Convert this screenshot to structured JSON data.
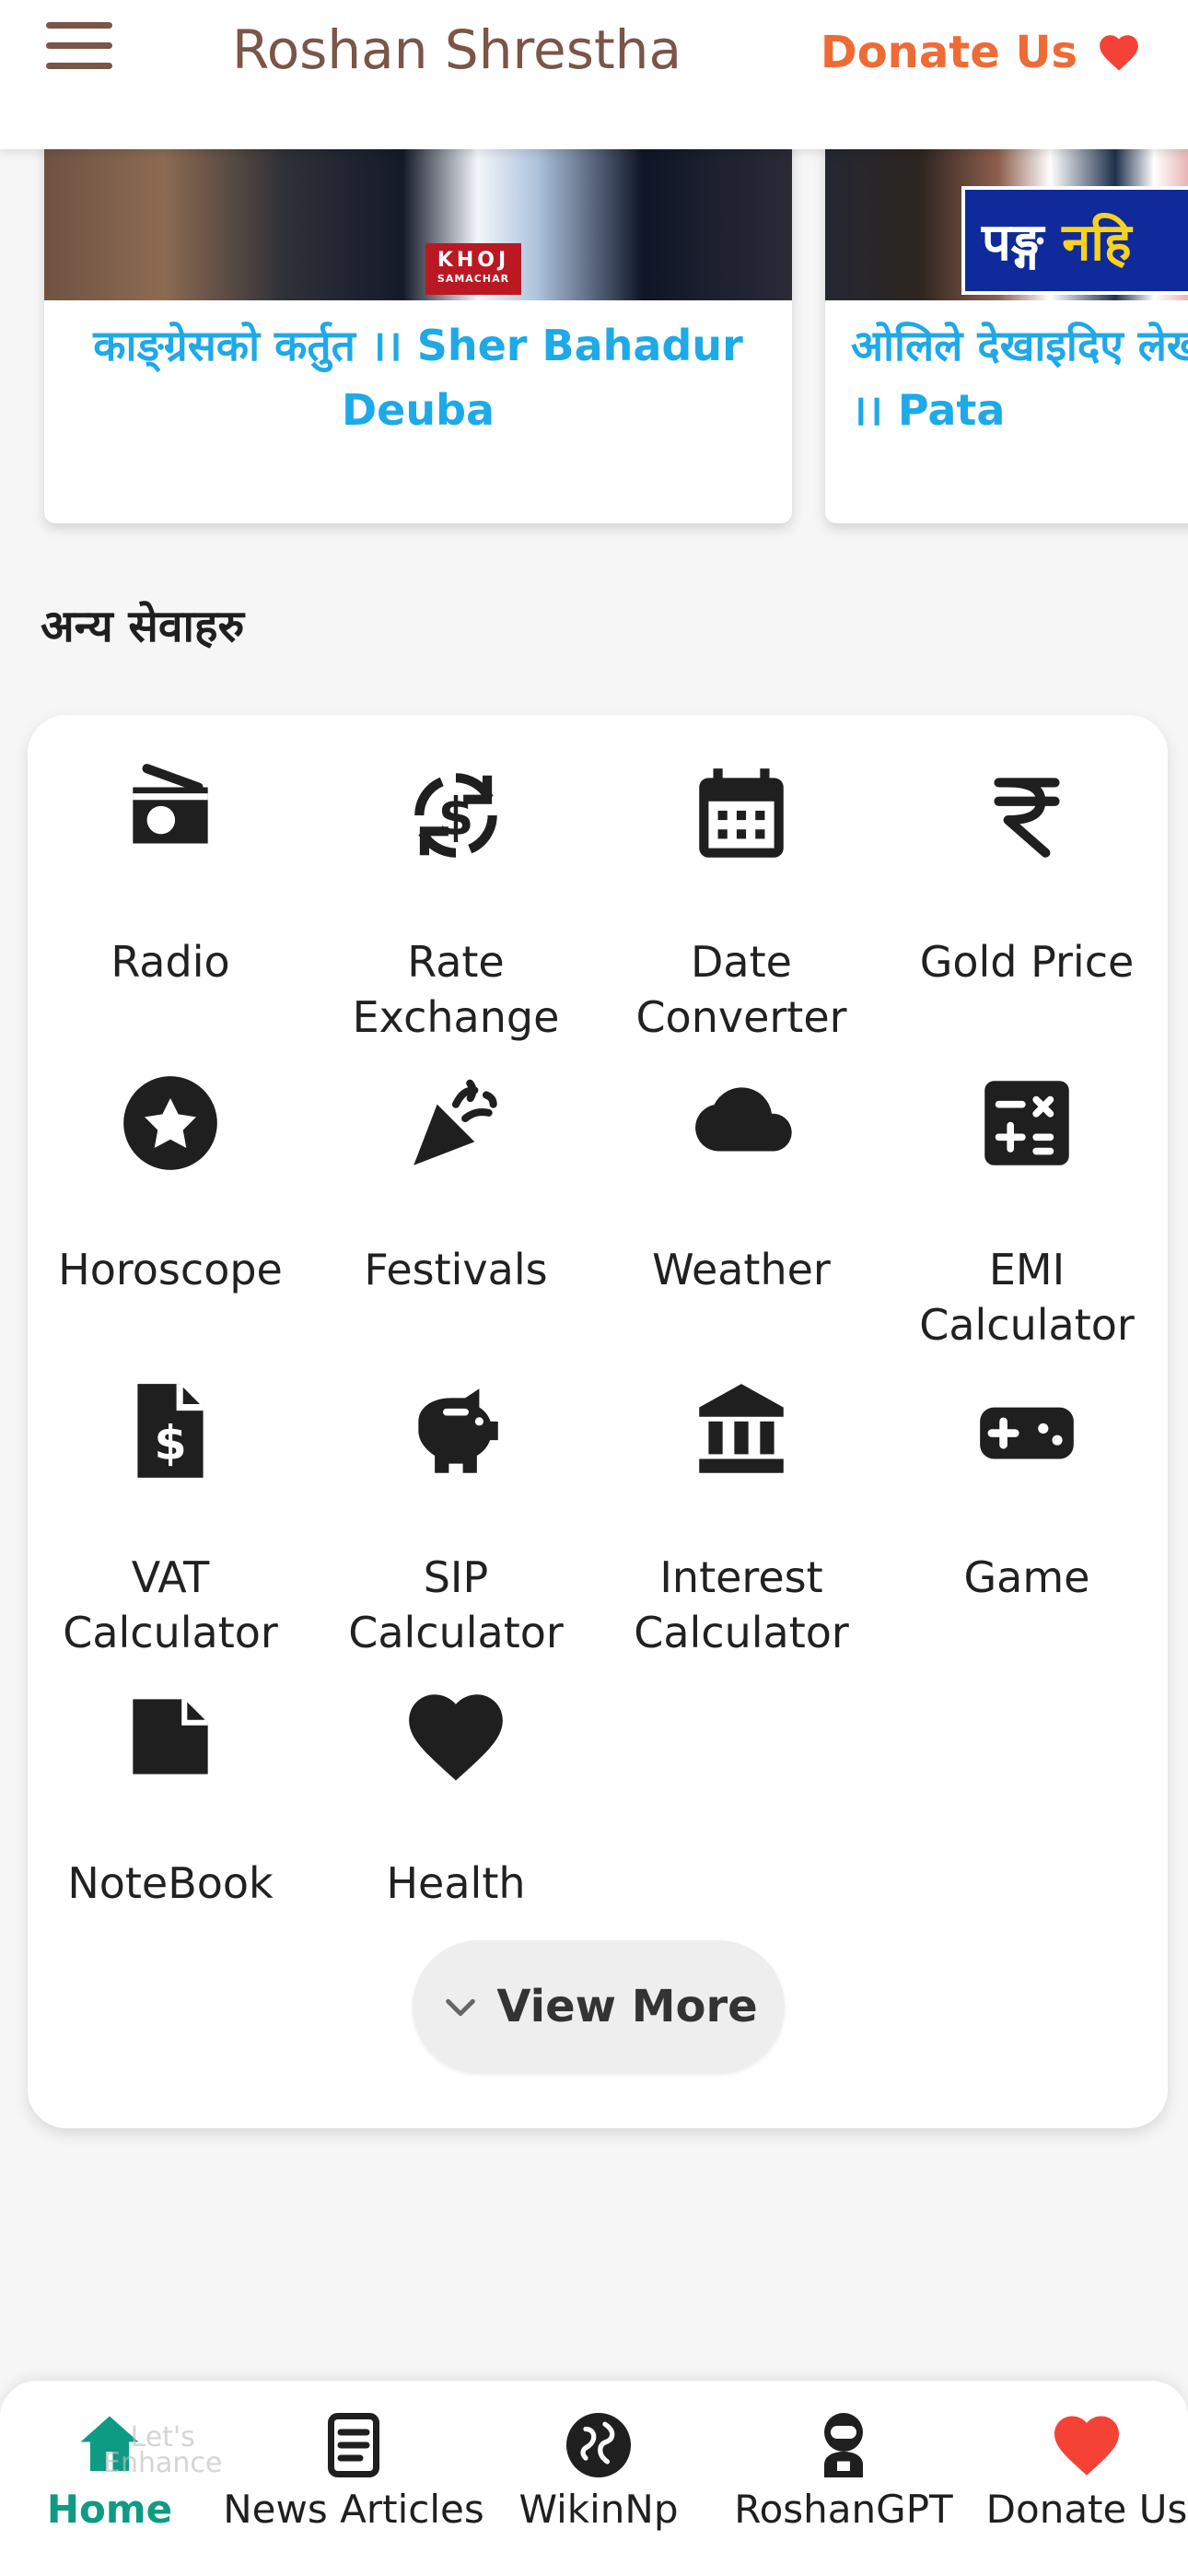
{
  "header": {
    "title": "Roshan Shrestha",
    "donate_label": "Donate Us",
    "accent_color": "#ef6b35",
    "title_color": "#7a5548"
  },
  "videos": [
    {
      "title": "काङ्ग्रेसको कर्तुत ।। Sher Bahadur Deuba",
      "thumb_text": "KHOJ",
      "thumb_subtext": "SAMACHAR"
    },
    {
      "title": "ओलिले देखाइदिए लेखक खुशी ।। Pata",
      "thumb_text_1": "पङ्ग",
      "thumb_text_2": "नहि"
    }
  ],
  "services": {
    "section_title": "अन्य सेवाहरु",
    "items": [
      {
        "label": "Radio",
        "icon": "radio-icon"
      },
      {
        "label": "Rate Exchange",
        "icon": "rate-exchange-icon"
      },
      {
        "label": "Date Converter",
        "icon": "calendar-icon"
      },
      {
        "label": "Gold Price",
        "icon": "rupee-icon"
      },
      {
        "label": "Horoscope",
        "icon": "star-circle-icon"
      },
      {
        "label": "Festivals",
        "icon": "celebration-icon"
      },
      {
        "label": "Weather",
        "icon": "cloud-icon"
      },
      {
        "label": "EMI Calculator",
        "icon": "calculator-icon"
      },
      {
        "label": "VAT Calculator",
        "icon": "invoice-dollar-icon"
      },
      {
        "label": "SIP Calculator",
        "icon": "piggy-bank-icon"
      },
      {
        "label": "Interest Calculator",
        "icon": "bank-icon"
      },
      {
        "label": "Game",
        "icon": "gamepad-icon"
      },
      {
        "label": "NoteBook",
        "icon": "note-icon"
      },
      {
        "label": "Health",
        "icon": "heart-icon"
      }
    ],
    "view_more_label": "View More"
  },
  "bottom_nav": {
    "items": [
      {
        "label": "Home",
        "icon": "home-icon",
        "active": true
      },
      {
        "label": "News Articles",
        "icon": "news-icon"
      },
      {
        "label": "WikinNp",
        "icon": "globe-icon"
      },
      {
        "label": "RoshanGPT",
        "icon": "astronaut-icon"
      },
      {
        "label": "Donate Us",
        "icon": "heart-icon"
      }
    ],
    "active_color": "#0d9b83",
    "heart_color": "#f44336",
    "badge_text": "Let's\nEnhance"
  }
}
